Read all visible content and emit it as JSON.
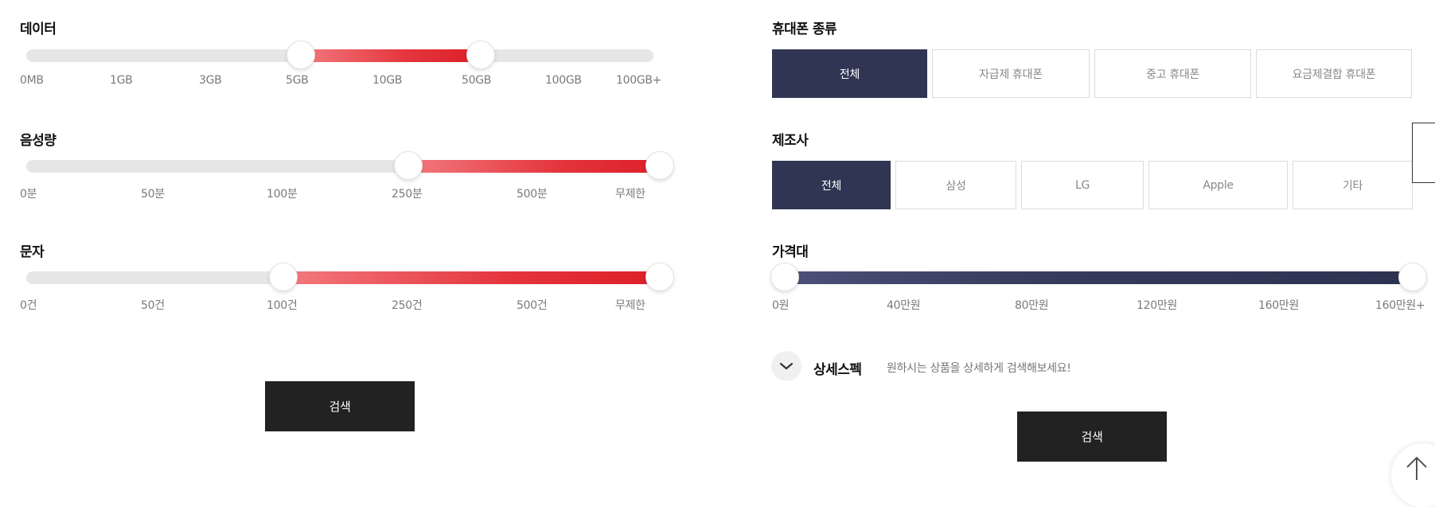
{
  "left": {
    "data": {
      "title": "데이터",
      "ticks": [
        "0MB",
        "1GB",
        "3GB",
        "5GB",
        "10GB",
        "50GB",
        "100GB",
        "100GB+"
      ],
      "selected_min": "5GB",
      "selected_max": "50GB"
    },
    "voice": {
      "title": "음성량",
      "ticks": [
        "0분",
        "50분",
        "100분",
        "250분",
        "500분",
        "무제한"
      ],
      "selected_min": "250분",
      "selected_max": "무제한"
    },
    "sms": {
      "title": "문자",
      "ticks": [
        "0건",
        "50건",
        "100건",
        "250건",
        "500건",
        "무제한"
      ],
      "selected_min": "100건",
      "selected_max": "무제한"
    },
    "search_label": "검색"
  },
  "right": {
    "phone_type": {
      "title": "휴대폰 종류",
      "options": [
        "전체",
        "자급제 휴대폰",
        "중고 휴대폰",
        "요금제결합 휴대폰"
      ],
      "selected": "전체"
    },
    "maker": {
      "title": "제조사",
      "options": [
        "전체",
        "삼성",
        "LG",
        "Apple",
        "기타"
      ],
      "selected": "전체"
    },
    "price": {
      "title": "가격대",
      "ticks": [
        "0원",
        "40만원",
        "80만원",
        "120만원",
        "160만원",
        "160만원+"
      ],
      "selected_min": "0원",
      "selected_max": "160만원+"
    },
    "detail": {
      "label": "상세스펙",
      "description": "원하시는 상품을 상세하게 검색해보세요!"
    },
    "search_label": "검색"
  },
  "icons": {
    "detail_toggle": "chevron-down-icon",
    "top": "arrow-up-icon"
  },
  "colors": {
    "accent_red": "#dc1f28",
    "navy": "#2f3552",
    "button_dark": "#222222",
    "track": "#e6e6e6"
  }
}
